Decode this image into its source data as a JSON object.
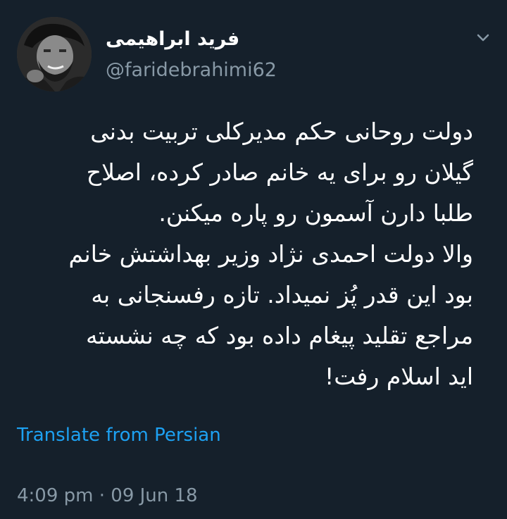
{
  "tweet": {
    "display_name": "فرید ابراهیمی",
    "handle": "@faridebrahimi62",
    "body": "دولت روحانی حکم مدیرکلی تربیت بدنی\nگیلان رو برای یه خانم صادر کرده، اصلاح\nطلبا دارن آسمون رو پاره میکنن.\nوالا دولت احمدی نژاد وزیر بهداشتش خانم\nبود این قدر پُز نمیداد. تازه رفسنجانی به\nمراجع تقلید پیغام داده بود که چه نشسته\nاید اسلام رفت!",
    "translate_label": "Translate from Persian",
    "timestamp": "4:09 pm · 09 Jun 18",
    "avatar_icon": "profile-photo",
    "menu_icon": "chevron-down-icon"
  },
  "colors": {
    "background": "#15202b",
    "text": "#ffffff",
    "secondary": "#8899a6",
    "link": "#1da1f2"
  }
}
